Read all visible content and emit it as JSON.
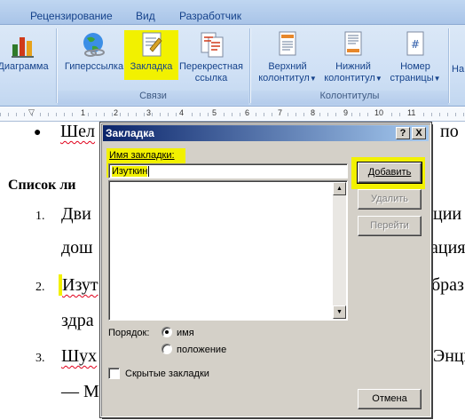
{
  "ribbon": {
    "tabs": [
      "Рецензирование",
      "Вид",
      "Разработчик"
    ],
    "buttons": {
      "diagram": "Диаграмма",
      "hyperlink": "Гиперссылка",
      "bookmark": "Закладка",
      "crossref_line1": "Перекрестная",
      "crossref_line2": "ссылка",
      "header_line1": "Верхний",
      "header_line2": "колонтитул",
      "footer_line1": "Нижний",
      "footer_line2": "колонтитул",
      "pagenum_line1": "Номер",
      "pagenum_line2": "страницы",
      "cut_off": "На"
    },
    "groups": {
      "links": "Связи",
      "headers": "Колонтитулы"
    },
    "ruler_numbers": [
      "1",
      "2",
      "3",
      "4",
      "5",
      "6",
      "7",
      "8",
      "9",
      "10",
      "11"
    ]
  },
  "document": {
    "line1_left": "Шел",
    "line1_right": "по",
    "heading": "Список ли",
    "items": [
      {
        "num": "1.",
        "left": "Дви",
        "right": "ции"
      },
      {
        "num": "",
        "left": "дош",
        "right": "ация"
      },
      {
        "num": "2.",
        "left": "Изут",
        "right": "браз"
      },
      {
        "num": "",
        "left": "здра",
        "right": ""
      },
      {
        "num": "3.",
        "left": "Шух",
        "right": "Энци"
      },
      {
        "num": "",
        "left": "— М",
        "right": ""
      }
    ]
  },
  "dialog": {
    "title": "Закладка",
    "help_btn": "?",
    "close_btn": "X",
    "name_label": "Имя закладки:",
    "name_value": "Изуткин",
    "add_btn": "Добавить",
    "delete_btn": "Удалить",
    "goto_btn": "Перейти",
    "order_label": "Порядок:",
    "sort_name": "имя",
    "sort_position": "положение",
    "sort_selected": "имя",
    "hidden_label": "Скрытые закладки",
    "hidden_checked": false,
    "cancel_btn": "Отмена"
  }
}
